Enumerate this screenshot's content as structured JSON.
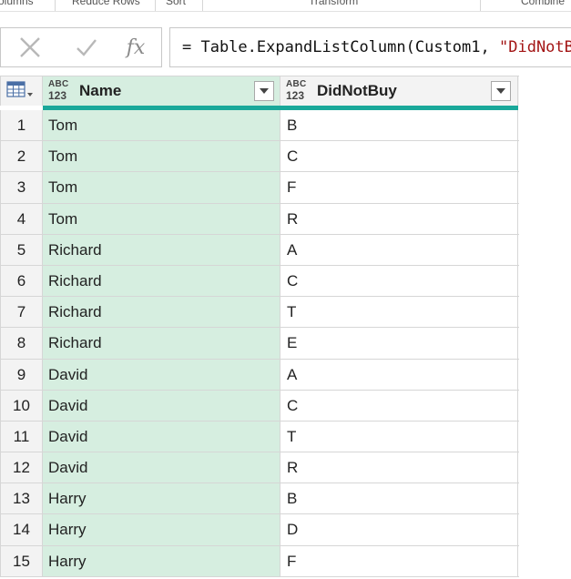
{
  "ribbon": {
    "groups": [
      "olumns",
      "Reduce Rows",
      "Sort",
      "Transform",
      "Combine"
    ]
  },
  "formula_bar": {
    "cancel_icon": "close-icon",
    "commit_icon": "check-icon",
    "fx_label": "fx",
    "formula_prefix": "= Table.ExpandListColumn(Custom1, ",
    "formula_string": "\"DidNotBuy\")"
  },
  "table": {
    "columns": [
      {
        "type_top": "ABC",
        "type_bottom": "123",
        "name": "Name"
      },
      {
        "type_top": "ABC",
        "type_bottom": "123",
        "name": "DidNotBuy"
      }
    ],
    "rows": [
      {
        "n": "1",
        "name": "Tom",
        "dnb": "B"
      },
      {
        "n": "2",
        "name": "Tom",
        "dnb": "C"
      },
      {
        "n": "3",
        "name": "Tom",
        "dnb": "F"
      },
      {
        "n": "4",
        "name": "Tom",
        "dnb": "R"
      },
      {
        "n": "5",
        "name": "Richard",
        "dnb": "A"
      },
      {
        "n": "6",
        "name": "Richard",
        "dnb": "C"
      },
      {
        "n": "7",
        "name": "Richard",
        "dnb": "T"
      },
      {
        "n": "8",
        "name": "Richard",
        "dnb": "E"
      },
      {
        "n": "9",
        "name": "David",
        "dnb": "A"
      },
      {
        "n": "10",
        "name": "David",
        "dnb": "C"
      },
      {
        "n": "11",
        "name": "David",
        "dnb": "T"
      },
      {
        "n": "12",
        "name": "David",
        "dnb": "R"
      },
      {
        "n": "13",
        "name": "Harry",
        "dnb": "B"
      },
      {
        "n": "14",
        "name": "Harry",
        "dnb": "D"
      },
      {
        "n": "15",
        "name": "Harry",
        "dnb": "F"
      }
    ]
  },
  "colors": {
    "selected_column": "#d6eee0",
    "quality_bar": "#1aa89a",
    "header_bg": "#f3f3f3",
    "formula_string": "#a31515"
  }
}
